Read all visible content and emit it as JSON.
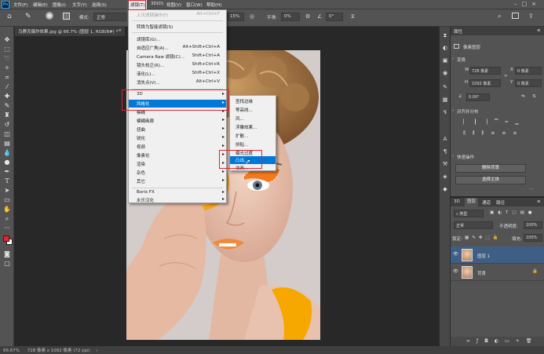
{
  "menubar": {
    "logo": "Ps",
    "items": [
      "文件(F)",
      "编辑(E)",
      "图像(I)",
      "文字(Y)",
      "选择(S)",
      "滤镜(T)",
      "3D(D)",
      "视图(V)",
      "窗口(W)",
      "帮助(H)"
    ]
  },
  "options": {
    "mode_label": "模式:",
    "mode_value": "正常",
    "opacity_value": "15%",
    "smoothing_label": "平滑:",
    "smoothing_value": "0%",
    "angle_value": "0°"
  },
  "document": {
    "tab_title": "马赛克爆炸效果.jpg @ 66.7% (图层 1, RGB/8#) *",
    "tab_close": "×"
  },
  "status": {
    "zoom": "66.67%",
    "size": "728 像素 x 1092 像素 (72 ppi)",
    "arrow": "›"
  },
  "filter_menu": {
    "items": [
      {
        "label": "上次滤镜操作(F)",
        "shortcut": "Alt+Ctrl+F",
        "disabled": true
      },
      {
        "label": "转换为智能滤镜(S)",
        "shortcut": ""
      },
      {
        "label": "滤镜库(G)...",
        "shortcut": ""
      },
      {
        "label": "自适应广角(A)...",
        "shortcut": "Alt+Shift+Ctrl+A"
      },
      {
        "label": "Camera Raw 滤镜(C)...",
        "shortcut": "Shift+Ctrl+A"
      },
      {
        "label": "镜头校正(R)...",
        "shortcut": "Shift+Ctrl+R"
      },
      {
        "label": "液化(L)...",
        "shortcut": "Shift+Ctrl+X"
      },
      {
        "label": "消失点(V)...",
        "shortcut": "Alt+Ctrl+V"
      },
      {
        "label": "3D",
        "submenu": true
      },
      {
        "label": "风格化",
        "submenu": true,
        "highlighted": true
      },
      {
        "label": "模糊",
        "submenu": true
      },
      {
        "label": "模糊画廊",
        "submenu": true
      },
      {
        "label": "扭曲",
        "submenu": true
      },
      {
        "label": "锐化",
        "submenu": true
      },
      {
        "label": "视频",
        "submenu": true
      },
      {
        "label": "像素化",
        "submenu": true
      },
      {
        "label": "渲染",
        "submenu": true
      },
      {
        "label": "杂色",
        "submenu": true
      },
      {
        "label": "其它",
        "submenu": true
      },
      {
        "label": "Borix FX",
        "submenu": true
      },
      {
        "label": "永乐汉化",
        "submenu": true
      }
    ]
  },
  "stylize_menu": {
    "items": [
      {
        "label": "查找边缘"
      },
      {
        "label": "等高线..."
      },
      {
        "label": "风..."
      },
      {
        "label": "浮雕效果..."
      },
      {
        "label": "扩散..."
      },
      {
        "label": "拼贴..."
      },
      {
        "label": "曝光过度"
      },
      {
        "label": "凸出...",
        "highlighted": true
      },
      {
        "label": "油画..."
      }
    ]
  },
  "properties": {
    "tabs": [
      "属性"
    ],
    "pixel_layer_label": "像素图层",
    "transform_label": "变换",
    "w_label": "W",
    "w_value": "728 像素",
    "h_label": "H",
    "h_value": "1092 像素",
    "x_label": "X",
    "x_value": "0 像素",
    "y_label": "Y",
    "y_value": "0 像素",
    "angle_value": "0.00°",
    "align_label": "对齐并分布",
    "quick_label": "快速操作",
    "remove_bg_button": "删除背景",
    "select_subject_button": "选择主体",
    "more": "···"
  },
  "layers": {
    "tabs": [
      "3D",
      "图层",
      "通道",
      "路径"
    ],
    "filter_kind": "类型",
    "blend_mode": "正常",
    "opacity_label": "不透明度:",
    "opacity_value": "100%",
    "lock_label": "锁定:",
    "fill_label": "填充:",
    "fill_value": "100%",
    "rows": [
      {
        "name": "图层 1",
        "selected": true
      },
      {
        "name": "背景",
        "selected": false
      }
    ]
  },
  "colors": {
    "menubar": "#535353",
    "highlight": "#0078d7",
    "annotation": "#e0243a",
    "foreground": "#e8242c",
    "background": "#ffffff"
  }
}
